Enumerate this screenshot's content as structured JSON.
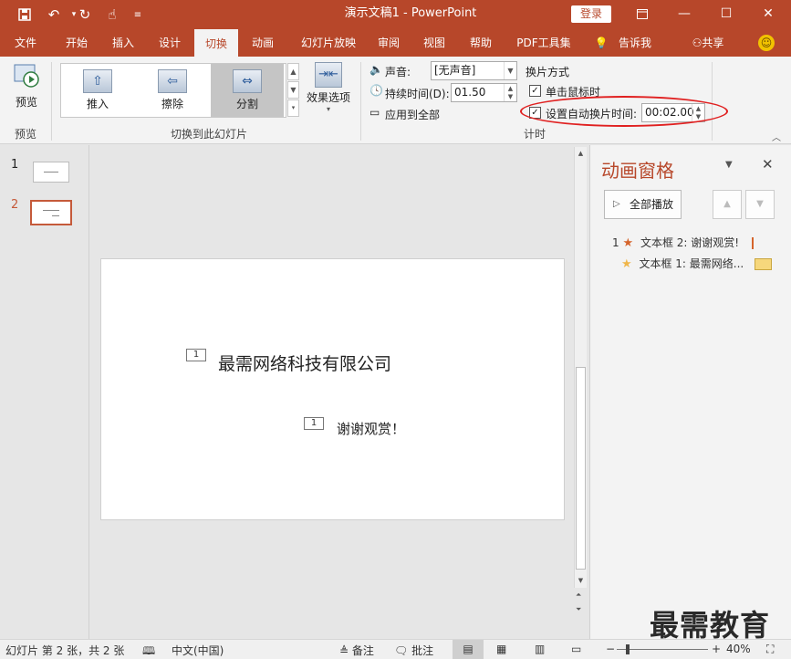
{
  "titlebar": {
    "title": "演示文稿1  -  PowerPoint",
    "login": "登录",
    "quick_access": {
      "save": "save-icon",
      "undo": "undo-icon",
      "redo": "redo-icon",
      "touch": "touch-mode-icon",
      "customize": "customize-icon"
    }
  },
  "tabs": [
    {
      "label": "文件"
    },
    {
      "label": "开始"
    },
    {
      "label": "插入"
    },
    {
      "label": "设计"
    },
    {
      "label": "切换"
    },
    {
      "label": "动画"
    },
    {
      "label": "幻灯片放映"
    },
    {
      "label": "审阅"
    },
    {
      "label": "视图"
    },
    {
      "label": "帮助"
    },
    {
      "label": "PDF工具集"
    },
    {
      "label": "告诉我"
    },
    {
      "label": "共享"
    }
  ],
  "ribbon": {
    "preview_label": "预览",
    "preview_group": "预览",
    "transitions": [
      {
        "label": "推入"
      },
      {
        "label": "擦除"
      },
      {
        "label": "分割"
      }
    ],
    "transitions_group": "切换到此幻灯片",
    "effect_options": "效果选项",
    "sound_label": "声音:",
    "sound_value": "[无声音]",
    "duration_label": "持续时间(D):",
    "duration_value": "01.50",
    "apply_all": "应用到全部",
    "advance_title": "换片方式",
    "on_click": "单击鼠标时",
    "after_label": "设置自动换片时间:",
    "after_value": "00:02.00",
    "timing_group": "计时"
  },
  "slides": [
    {
      "number": "1"
    },
    {
      "number": "2"
    }
  ],
  "slide": {
    "title": "最需网络科技有限公司",
    "subtitle": "谢谢观赏！",
    "tag1": "1",
    "tag2": "1"
  },
  "anim_pane": {
    "title": "动画窗格",
    "play_all": "全部播放",
    "items": [
      {
        "index": "1",
        "text": "文本框 2: 谢谢观赏!"
      },
      {
        "index": "",
        "text": "文本框 1: 最需网络..."
      }
    ]
  },
  "status": {
    "slide_info": "幻灯片 第 2 张，共 2 张",
    "language": "中文(中国)",
    "notes": "备注",
    "comments": "批注",
    "zoom": "40%"
  },
  "watermark": "最需教育",
  "colors": {
    "accent": "#b7472a",
    "highlight": "#e02020"
  }
}
